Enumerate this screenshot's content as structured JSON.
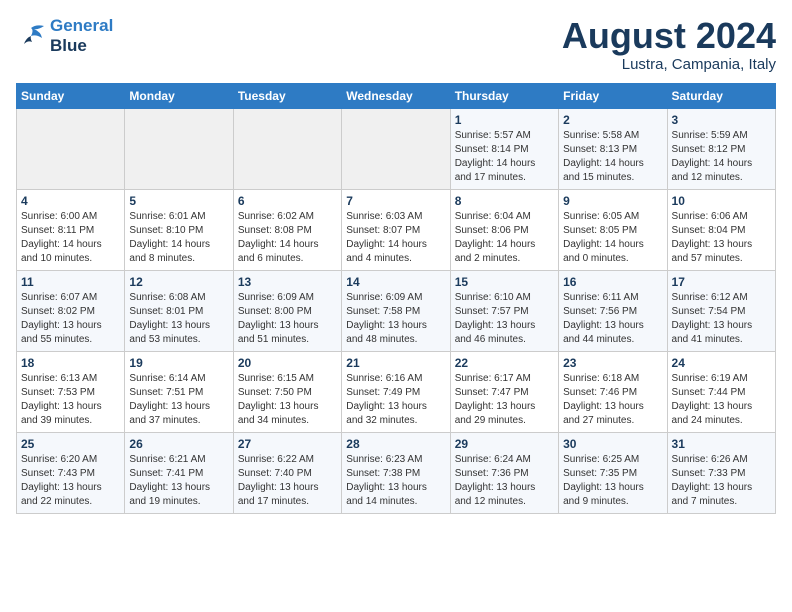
{
  "header": {
    "logo_line1": "General",
    "logo_line2": "Blue",
    "title": "August 2024",
    "subtitle": "Lustra, Campania, Italy"
  },
  "weekdays": [
    "Sunday",
    "Monday",
    "Tuesday",
    "Wednesday",
    "Thursday",
    "Friday",
    "Saturday"
  ],
  "weeks": [
    [
      {
        "day": "",
        "info": ""
      },
      {
        "day": "",
        "info": ""
      },
      {
        "day": "",
        "info": ""
      },
      {
        "day": "",
        "info": ""
      },
      {
        "day": "1",
        "info": "Sunrise: 5:57 AM\nSunset: 8:14 PM\nDaylight: 14 hours\nand 17 minutes."
      },
      {
        "day": "2",
        "info": "Sunrise: 5:58 AM\nSunset: 8:13 PM\nDaylight: 14 hours\nand 15 minutes."
      },
      {
        "day": "3",
        "info": "Sunrise: 5:59 AM\nSunset: 8:12 PM\nDaylight: 14 hours\nand 12 minutes."
      }
    ],
    [
      {
        "day": "4",
        "info": "Sunrise: 6:00 AM\nSunset: 8:11 PM\nDaylight: 14 hours\nand 10 minutes."
      },
      {
        "day": "5",
        "info": "Sunrise: 6:01 AM\nSunset: 8:10 PM\nDaylight: 14 hours\nand 8 minutes."
      },
      {
        "day": "6",
        "info": "Sunrise: 6:02 AM\nSunset: 8:08 PM\nDaylight: 14 hours\nand 6 minutes."
      },
      {
        "day": "7",
        "info": "Sunrise: 6:03 AM\nSunset: 8:07 PM\nDaylight: 14 hours\nand 4 minutes."
      },
      {
        "day": "8",
        "info": "Sunrise: 6:04 AM\nSunset: 8:06 PM\nDaylight: 14 hours\nand 2 minutes."
      },
      {
        "day": "9",
        "info": "Sunrise: 6:05 AM\nSunset: 8:05 PM\nDaylight: 14 hours\nand 0 minutes."
      },
      {
        "day": "10",
        "info": "Sunrise: 6:06 AM\nSunset: 8:04 PM\nDaylight: 13 hours\nand 57 minutes."
      }
    ],
    [
      {
        "day": "11",
        "info": "Sunrise: 6:07 AM\nSunset: 8:02 PM\nDaylight: 13 hours\nand 55 minutes."
      },
      {
        "day": "12",
        "info": "Sunrise: 6:08 AM\nSunset: 8:01 PM\nDaylight: 13 hours\nand 53 minutes."
      },
      {
        "day": "13",
        "info": "Sunrise: 6:09 AM\nSunset: 8:00 PM\nDaylight: 13 hours\nand 51 minutes."
      },
      {
        "day": "14",
        "info": "Sunrise: 6:09 AM\nSunset: 7:58 PM\nDaylight: 13 hours\nand 48 minutes."
      },
      {
        "day": "15",
        "info": "Sunrise: 6:10 AM\nSunset: 7:57 PM\nDaylight: 13 hours\nand 46 minutes."
      },
      {
        "day": "16",
        "info": "Sunrise: 6:11 AM\nSunset: 7:56 PM\nDaylight: 13 hours\nand 44 minutes."
      },
      {
        "day": "17",
        "info": "Sunrise: 6:12 AM\nSunset: 7:54 PM\nDaylight: 13 hours\nand 41 minutes."
      }
    ],
    [
      {
        "day": "18",
        "info": "Sunrise: 6:13 AM\nSunset: 7:53 PM\nDaylight: 13 hours\nand 39 minutes."
      },
      {
        "day": "19",
        "info": "Sunrise: 6:14 AM\nSunset: 7:51 PM\nDaylight: 13 hours\nand 37 minutes."
      },
      {
        "day": "20",
        "info": "Sunrise: 6:15 AM\nSunset: 7:50 PM\nDaylight: 13 hours\nand 34 minutes."
      },
      {
        "day": "21",
        "info": "Sunrise: 6:16 AM\nSunset: 7:49 PM\nDaylight: 13 hours\nand 32 minutes."
      },
      {
        "day": "22",
        "info": "Sunrise: 6:17 AM\nSunset: 7:47 PM\nDaylight: 13 hours\nand 29 minutes."
      },
      {
        "day": "23",
        "info": "Sunrise: 6:18 AM\nSunset: 7:46 PM\nDaylight: 13 hours\nand 27 minutes."
      },
      {
        "day": "24",
        "info": "Sunrise: 6:19 AM\nSunset: 7:44 PM\nDaylight: 13 hours\nand 24 minutes."
      }
    ],
    [
      {
        "day": "25",
        "info": "Sunrise: 6:20 AM\nSunset: 7:43 PM\nDaylight: 13 hours\nand 22 minutes."
      },
      {
        "day": "26",
        "info": "Sunrise: 6:21 AM\nSunset: 7:41 PM\nDaylight: 13 hours\nand 19 minutes."
      },
      {
        "day": "27",
        "info": "Sunrise: 6:22 AM\nSunset: 7:40 PM\nDaylight: 13 hours\nand 17 minutes."
      },
      {
        "day": "28",
        "info": "Sunrise: 6:23 AM\nSunset: 7:38 PM\nDaylight: 13 hours\nand 14 minutes."
      },
      {
        "day": "29",
        "info": "Sunrise: 6:24 AM\nSunset: 7:36 PM\nDaylight: 13 hours\nand 12 minutes."
      },
      {
        "day": "30",
        "info": "Sunrise: 6:25 AM\nSunset: 7:35 PM\nDaylight: 13 hours\nand 9 minutes."
      },
      {
        "day": "31",
        "info": "Sunrise: 6:26 AM\nSunset: 7:33 PM\nDaylight: 13 hours\nand 7 minutes."
      }
    ]
  ]
}
